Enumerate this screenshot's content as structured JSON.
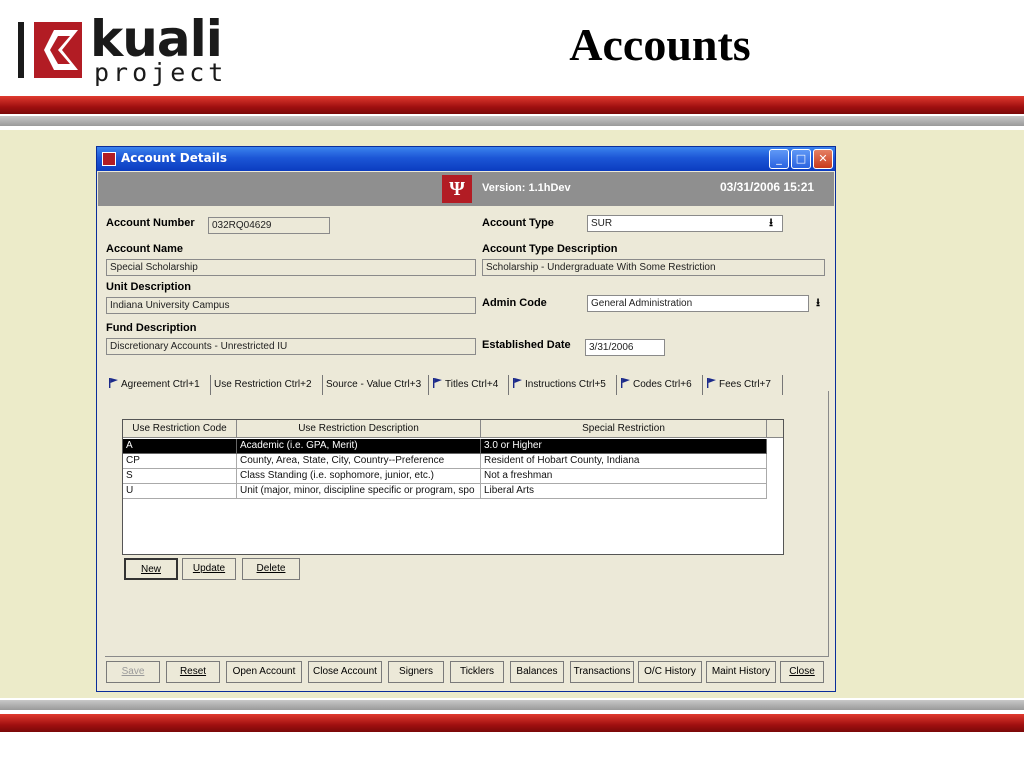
{
  "slide": {
    "logo_word": "kuali",
    "logo_sub": "project",
    "title": "Accounts"
  },
  "colors": {
    "brand_red": "#b21c24",
    "title_bar": "#1c56d6",
    "background": "#ecebc9"
  },
  "window": {
    "title": "Account Details",
    "version": "Version: 1.1hDev",
    "datetime": "03/31/2006 15:21",
    "controls": [
      "minimize-icon",
      "maximize-icon",
      "close-icon"
    ]
  },
  "form": {
    "account_number_label": "Account Number",
    "account_number": "032RQ04629",
    "account_name_label": "Account Name",
    "account_name": "Special Scholarship",
    "unit_description_label": "Unit Description",
    "unit_description": "Indiana University Campus",
    "fund_description_label": "Fund Description",
    "fund_description": "Discretionary Accounts - Unrestricted IU",
    "account_type_label": "Account Type",
    "account_type": "SUR",
    "account_type_desc_label": "Account Type Description",
    "account_type_desc": "Scholarship - Undergraduate With Some Restriction",
    "admin_code_label": "Admin Code",
    "admin_code": "General Administration",
    "established_date_label": "Established Date",
    "established_date": "3/31/2006"
  },
  "tabs": [
    {
      "label": "Agreement Ctrl+1",
      "flag": true
    },
    {
      "label": "Use Restriction Ctrl+2",
      "flag": false
    },
    {
      "label": "Source - Value Ctrl+3",
      "flag": false
    },
    {
      "label": "Titles Ctrl+4",
      "flag": true
    },
    {
      "label": "Instructions Ctrl+5",
      "flag": true
    },
    {
      "label": "Codes Ctrl+6",
      "flag": true
    },
    {
      "label": "Fees Ctrl+7",
      "flag": true
    }
  ],
  "grid": {
    "headers": [
      "Use Restriction Code",
      "Use Restriction Description",
      "Special Restriction"
    ],
    "rows": [
      {
        "code": "A",
        "description": "Academic (i.e. GPA, Merit)",
        "special": "3.0 or Higher",
        "selected": true
      },
      {
        "code": "CP",
        "description": "County, Area, State, City, Country--Preference",
        "special": "Resident of Hobart County, Indiana",
        "selected": false
      },
      {
        "code": "S",
        "description": "Class Standing (i.e. sophomore, junior, etc.)",
        "special": "Not a freshman",
        "selected": false
      },
      {
        "code": "U",
        "description": "Unit (major, minor, discipline specific or program, spo",
        "special": "Liberal Arts",
        "selected": false
      }
    ]
  },
  "grid_buttons": {
    "new": "New",
    "update": "Update",
    "delete": "Delete"
  },
  "bottom_buttons": {
    "save": "Save",
    "reset": "Reset",
    "open_account": "Open Account",
    "close_account": "Close Account",
    "signers": "Signers",
    "ticklers": "Ticklers",
    "balances": "Balances",
    "transactions": "Transactions",
    "oc_history": "O/C History",
    "maint_history": "Maint History",
    "close": "Close"
  }
}
